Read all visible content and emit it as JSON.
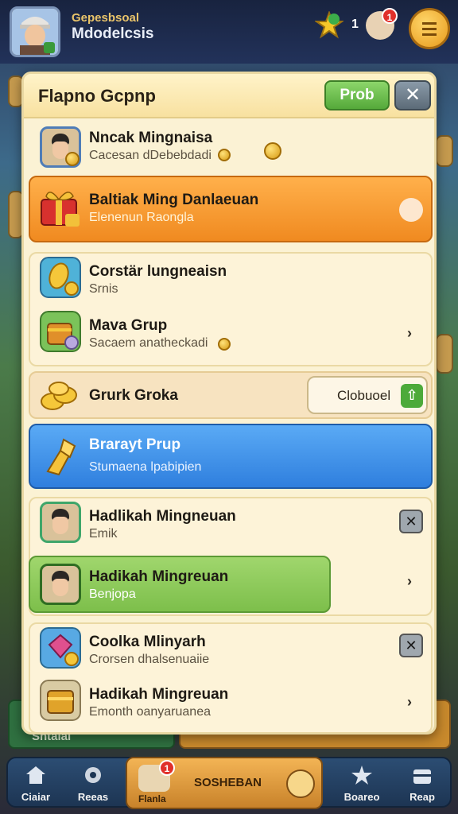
{
  "header": {
    "player_title": "Gepesbsoal",
    "player_name": "Mdodelcsis",
    "star_count": "1",
    "notif_badge": "1"
  },
  "panel": {
    "title": "Flapno Gcpnp",
    "primary_button": "Prob",
    "close_glyph": "✕"
  },
  "rows": [
    {
      "title": "Nncak Mingnaisa",
      "subtitle": "Cacesan dDebebdadi",
      "icon": "avatar-boy-icon"
    },
    {
      "title": "Baltiak Ming Danlaeuan",
      "subtitle": "Elenenun Raongla",
      "icon": "gift-box-icon",
      "highlight": "#f39a2e"
    },
    {
      "title": "Corstär lungneaisn",
      "subtitle": "Srnis",
      "icon": "gold-coin-icon"
    },
    {
      "title": "Mava Grup",
      "subtitle": "Sacaem anatheckadi",
      "icon": "treasure-chest-icon"
    },
    {
      "title": "Grurk Groka",
      "subtitle": "",
      "icon": "coin-stack-icon",
      "button": "Clobuoel"
    },
    {
      "title": "Brarayt Prup",
      "subtitle": "Stumaena lpabipien",
      "icon": "golden-key-icon",
      "highlight": "#3a8be6"
    },
    {
      "title": "Hadlikah Mingneuan",
      "subtitle": "Emik",
      "icon": "avatar-boy-icon"
    },
    {
      "title": "Hadikah Mingreuan",
      "subtitle": "Benjopa",
      "icon": "avatar-boy-icon",
      "highlight": "#8ccc5a"
    },
    {
      "title": "Coolka Mlinyarh",
      "subtitle": "Crorsen dhalsenuaiie",
      "icon": "pink-gem-icon"
    },
    {
      "title": "Hadikah Mingreuan",
      "subtitle": "Emonth oanyaruanea",
      "icon": "treasure-chest-icon"
    }
  ],
  "bottom_bar_partial": "Shtaial",
  "nav": [
    {
      "label": "Ciaiar",
      "icon": "home-icon"
    },
    {
      "label": "Reeas",
      "icon": "gear-icon"
    },
    {
      "label": "Flanla",
      "icon": "cookie-icon"
    },
    {
      "label": "Boareo",
      "icon": "star-icon"
    },
    {
      "label": "Reap",
      "icon": "treasure-icon"
    }
  ],
  "nav_center_label": "SOSHEBAN",
  "nav_badge": "1",
  "colors": {
    "accent_orange": "#f39a2e",
    "accent_blue": "#3a8be6",
    "accent_green": "#8ccc5a",
    "panel_bg": "#fbf2d4"
  }
}
